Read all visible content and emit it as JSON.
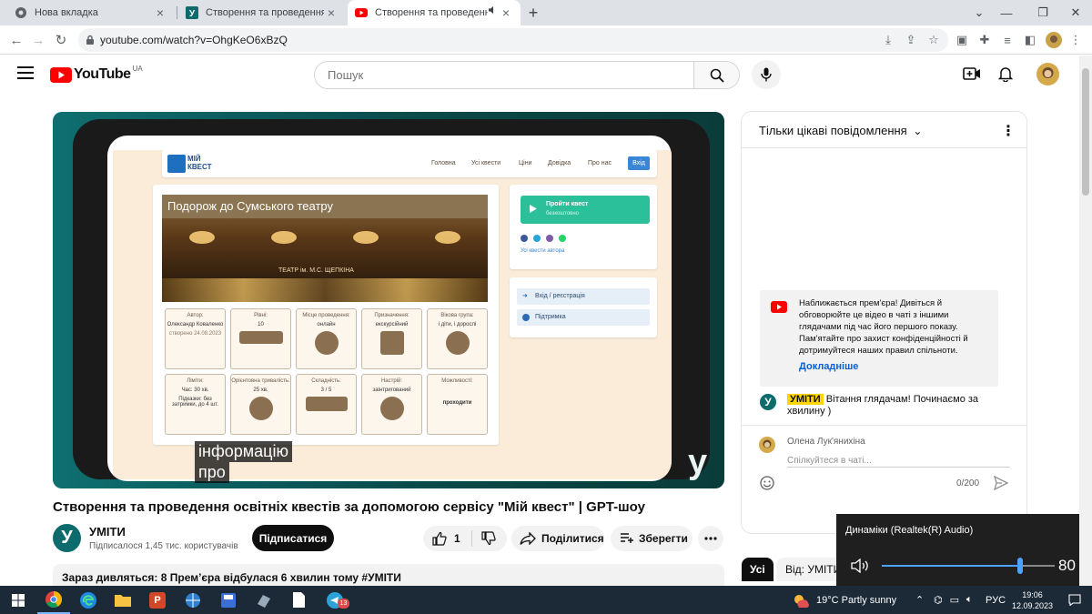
{
  "browser": {
    "tabs": [
      {
        "title": "Нова вкладка"
      },
      {
        "title": "Створення та проведення освіт"
      },
      {
        "title": "Створення та проведення с"
      }
    ],
    "url": "youtube.com/watch?v=OhgKeO6xBzQ"
  },
  "youtube": {
    "logo_text": "YouTube",
    "region": "UA",
    "search_placeholder": "Пошук"
  },
  "video": {
    "site": {
      "logo_top": "МІЙ",
      "logo_bottom": "КВЕСТ",
      "nav": [
        "Головна",
        "Усі квести",
        "Ціни",
        "Довідка",
        "Про нас"
      ],
      "login": "Вхід",
      "quest_title": "Подорож до Сумського театру",
      "theatre_sign": "ТЕАТР ім. М.С. ЩЕПКІНА",
      "start_button": "Пройти квест",
      "start_sub": "безкоштовно",
      "author_quests": "Усі квести автора",
      "login_register": "Вхід / реєстрація",
      "support": "Підтримка",
      "stats": [
        {
          "label": "Автор:",
          "value": "Олександр Коваленко",
          "extra": "створено 24.08.2023"
        },
        {
          "label": "Рівні:",
          "value": "10"
        },
        {
          "label": "Місце проведення:",
          "value": "онлайн"
        },
        {
          "label": "Призначення:",
          "value": "екскурсійний"
        },
        {
          "label": "Вікова група:",
          "value": "і діти, і дорослі"
        },
        {
          "label": "Ліміти:",
          "value": "Час: 30 хв.",
          "extra": "Підказки: без затримки, до 4 шт."
        },
        {
          "label": "Орієнтовна тривалість:",
          "value": "25 хв."
        },
        {
          "label": "Складність:",
          "value": "3 / 5"
        },
        {
          "label": "Настрій:",
          "value": "заінтригований"
        },
        {
          "label": "Можливості:",
          "value": "проходити"
        }
      ]
    },
    "captions": [
      "інформацію",
      "про"
    ],
    "watermark": "у"
  },
  "meta": {
    "title": "Створення та проведення освітніх квестів за допомогою сервісу \"Мій квест\" | GPT-шоу",
    "channel_initial": "У",
    "channel": "УМІТИ",
    "subscribers": "Підписалося 1,45 тис. користувачів",
    "subscribe": "Підписатися",
    "likes": "1",
    "share": "Поділитися",
    "save": "Зберегти",
    "description": "Зараз дивляться: 8  Прем’єра відбулася 6 хвилин тому  #УМІТИ"
  },
  "chat": {
    "mode": "Тільки цікаві повідомлення",
    "notice": "Наближається прем'єра! Дивіться й обговорюйте це відео в чаті з іншими глядачами під час його першого показу. Пам'ятайте про захист конфіденційності й дотримуйтеся наших правил спільноти.",
    "notice_link": "Докладніше",
    "message_author": "УМІТИ",
    "message_text": "Вітання глядачам! Починаємо за хвилину )",
    "user": "Олена Лук'янихіна",
    "input_placeholder": "Спілкуйтеся в чаті...",
    "counter": "0/200"
  },
  "chips": {
    "all": "Усі",
    "from": "Від: УМІТИ"
  },
  "volume": {
    "device": "Динаміки (Realtek(R) Audio)",
    "level": 80
  },
  "taskbar": {
    "weather": "19°C  Partly sunny",
    "lang": "РУС",
    "time": "19:06",
    "date": "12.09.2023",
    "telegram_badge": "13"
  },
  "colors": {
    "yt_red": "#ff0000",
    "link_blue": "#065fd4",
    "teal": "#0e6b6d",
    "quest_green": "#2bbf9a"
  }
}
